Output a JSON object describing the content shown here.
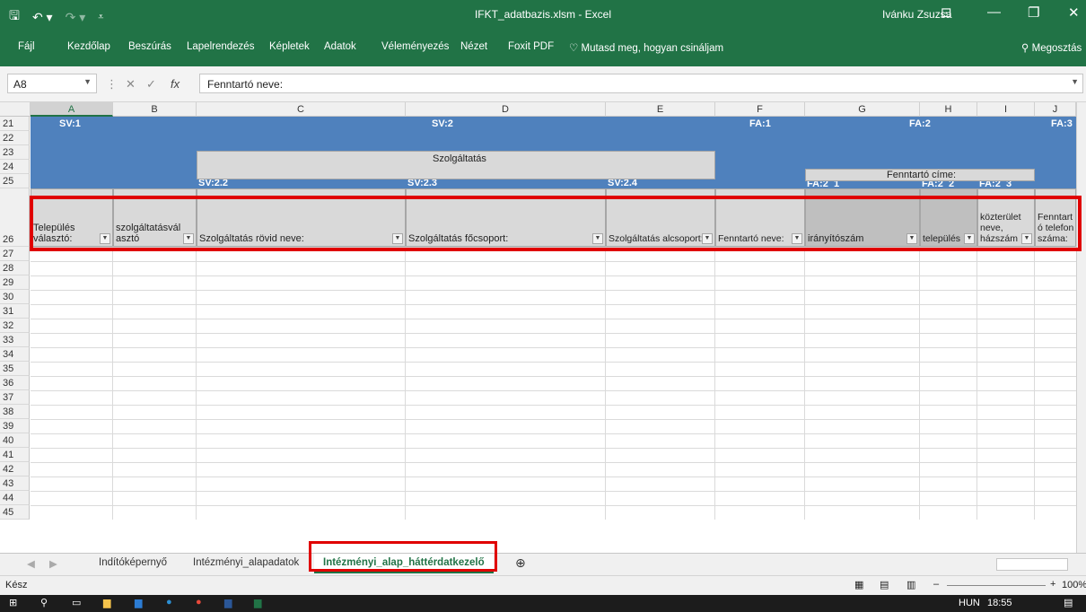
{
  "window": {
    "title": "IFKT_adatbazis.xlsm - Excel",
    "user": "Ivánku Zsuzsa"
  },
  "ribbon": {
    "tabs": [
      "Fájl",
      "Kezdőlap",
      "Beszúrás",
      "Lapelrendezés",
      "Képletek",
      "Adatok",
      "Véleményezés",
      "Nézet",
      "Foxit PDF"
    ],
    "tell_me": "Mutasd meg, hogyan csináljam",
    "share": "Megosztás"
  },
  "formula_bar": {
    "name_box": "A8",
    "content": "Fenntartó neve:"
  },
  "columns": [
    "A",
    "B",
    "C",
    "D",
    "E",
    "F",
    "G",
    "H",
    "I",
    "J"
  ],
  "selected_column": "A",
  "rows": [
    "21",
    "22",
    "23",
    "24",
    "25",
    "26",
    "27",
    "28",
    "29",
    "30",
    "31",
    "32",
    "33",
    "34",
    "35",
    "36",
    "37",
    "38",
    "39",
    "40",
    "41",
    "42",
    "43",
    "44",
    "45"
  ],
  "header_labels": {
    "sv1": "SV:1",
    "sv2": "SV:2",
    "fa1": "FA:1",
    "fa2": "FA:2",
    "fa3": "FA:3",
    "szolgaltatas": "Szolgáltatás",
    "fenntarto_cime": "Fenntartó címe:",
    "sv22": "SV:2.2",
    "sv23": "SV:2.3",
    "sv24": "SV:2.4",
    "fa21": "FA:2_1",
    "fa22": "FA:2_2",
    "fa23": "FA:2_3"
  },
  "filter_headers": [
    "Település választó:",
    "szolgáltatásválasztó",
    "Szolgáltatás rövid neve:",
    "Szolgáltatás főcsoport:",
    "Szolgáltatás alcsoport:",
    "Fenntartó neve:",
    "irányítószám",
    "település",
    "közterület neve, házszám",
    "Fenntartó telefonszáma:"
  ],
  "sheet_tabs": [
    "Indítóképernyő",
    "Intézményi_alapadatok",
    "Intézményi_alap_háttérdatkezelő"
  ],
  "active_sheet": "Intézményi_alap_háttérdatkezelő",
  "status": {
    "ready": "Kész",
    "zoom": "100%"
  },
  "taskbar": {
    "language": "HUN",
    "time": "18:55"
  }
}
